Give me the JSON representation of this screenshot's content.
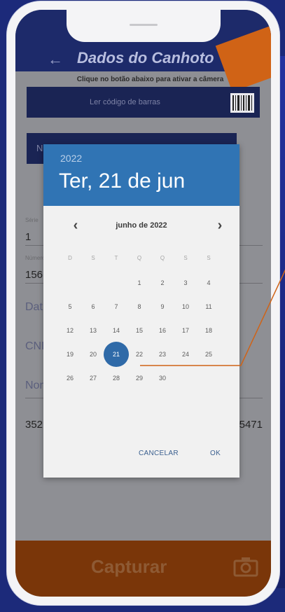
{
  "app": {
    "title": "Dados do Canhoto",
    "hint": "Clique no botão abaixo para ativar a câmera",
    "scan_button": "Ler código de barras",
    "nf_label": "NF-e",
    "capture_button": "Capturar"
  },
  "fields": [
    {
      "label": "Série",
      "value": "1"
    },
    {
      "label": "Número",
      "value": "156"
    }
  ],
  "form_partial": {
    "data": "Dat",
    "cnpj": "CNP",
    "nome": "Nom",
    "chave_value": "352",
    "chave_suffix": "5471"
  },
  "date_picker": {
    "year": "2022",
    "header_date": "Ter, 21 de jun",
    "month_label": "junho de 2022",
    "weekdays": [
      "D",
      "S",
      "T",
      "Q",
      "Q",
      "S",
      "S"
    ],
    "days": [
      "1",
      "2",
      "3",
      "4",
      "5",
      "6",
      "7",
      "8",
      "9",
      "10",
      "11",
      "12",
      "13",
      "14",
      "15",
      "16",
      "17",
      "18",
      "19",
      "20",
      "21",
      "22",
      "23",
      "24",
      "25",
      "26",
      "27",
      "28",
      "29",
      "30"
    ],
    "selected_day": "21",
    "cancel_label": "CANCELAR",
    "ok_label": "OK"
  },
  "colors": {
    "accent_orange": "#d06316",
    "dialog_header": "#3074b4",
    "selected_day": "#2f6aa8",
    "navy": "#1d2a6a"
  },
  "icons": [
    "back-arrow-icon",
    "barcode-icon",
    "camera-icon",
    "chevron-left-icon",
    "chevron-right-icon"
  ]
}
